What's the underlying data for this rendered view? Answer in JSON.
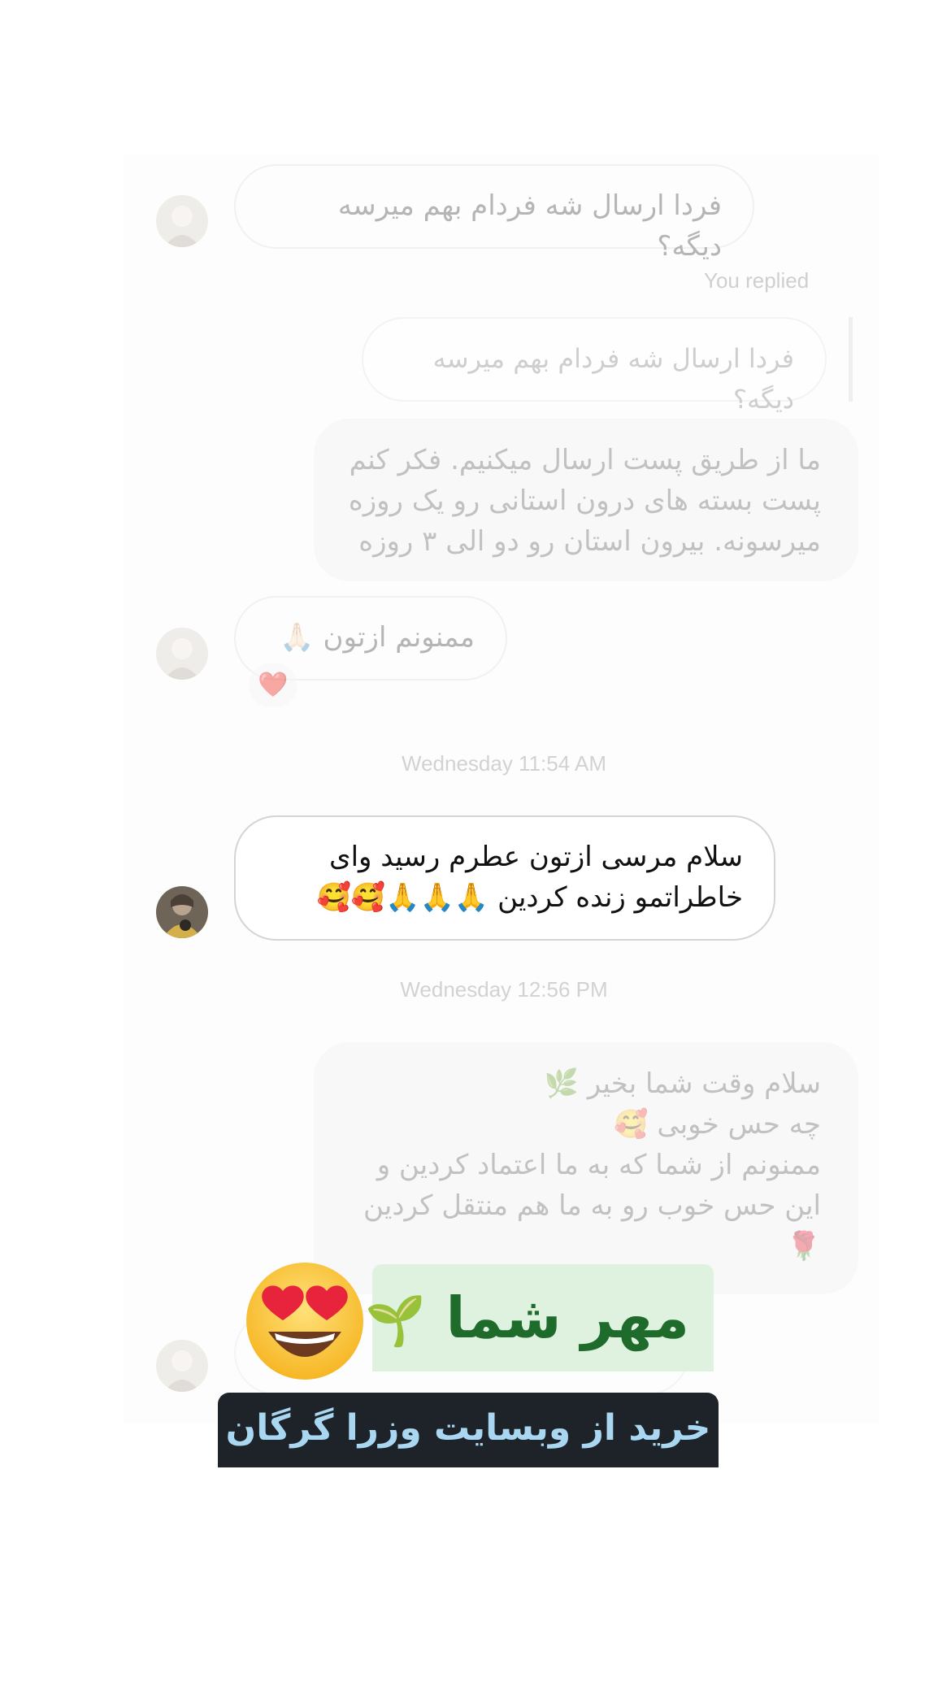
{
  "thread": {
    "messages": [
      {
        "id": "m1",
        "side": "incoming",
        "text": "فردا ارسال شه فردام بهم میرسه دیگه؟"
      },
      {
        "id": "m2_label",
        "text": "You replied"
      },
      {
        "id": "m2_quote",
        "text": "فردا ارسال شه فردام بهم میرسه دیگه؟"
      },
      {
        "id": "m3",
        "side": "outgoing",
        "lines": [
          "ما از طریق پست ارسال میکنیم. فکر کنم",
          "پست بسته های درون استانی رو یک روزه",
          "میرسونه. بیرون استان رو دو الی ۳ روزه"
        ]
      },
      {
        "id": "m4",
        "side": "incoming",
        "text": "ممنونم ازتون 🙏🏻",
        "reaction": "❤️"
      },
      {
        "id": "ts1",
        "text": "Wednesday 11:54 AM"
      },
      {
        "id": "m5",
        "side": "incoming",
        "lines": [
          "سلام مرسی ازتون عطرم رسید وای",
          "خاطراتمو زنده کردین 🙏🙏🙏🥰🥰"
        ]
      },
      {
        "id": "ts2",
        "text": "Wednesday 12:56 PM"
      },
      {
        "id": "m6",
        "side": "outgoing",
        "lines": [
          "سلام وقت شما بخیر 🌿",
          "چه حس خوبی 🥰",
          "ممنونم از شما که به ما اعتماد کردین و",
          "این حس خوب رو به ما هم منتقل کردین",
          "🌹"
        ]
      }
    ]
  },
  "stickers": {
    "mehr": {
      "text": "مهر شما",
      "emoji": "🌱"
    },
    "buy": {
      "text": "خرید از وبسایت وزرا گرگان"
    },
    "big_emoji": "heart-eyes-emoji"
  },
  "colors": {
    "incoming_border": "#dcdcdc",
    "outgoing_bg": "#efefef",
    "sticker_green_bg": "#dff2df",
    "sticker_green_text": "#1f6b2c",
    "sticker_dark_bg": "#1d2328",
    "sticker_dark_text": "#a9d7f2"
  }
}
